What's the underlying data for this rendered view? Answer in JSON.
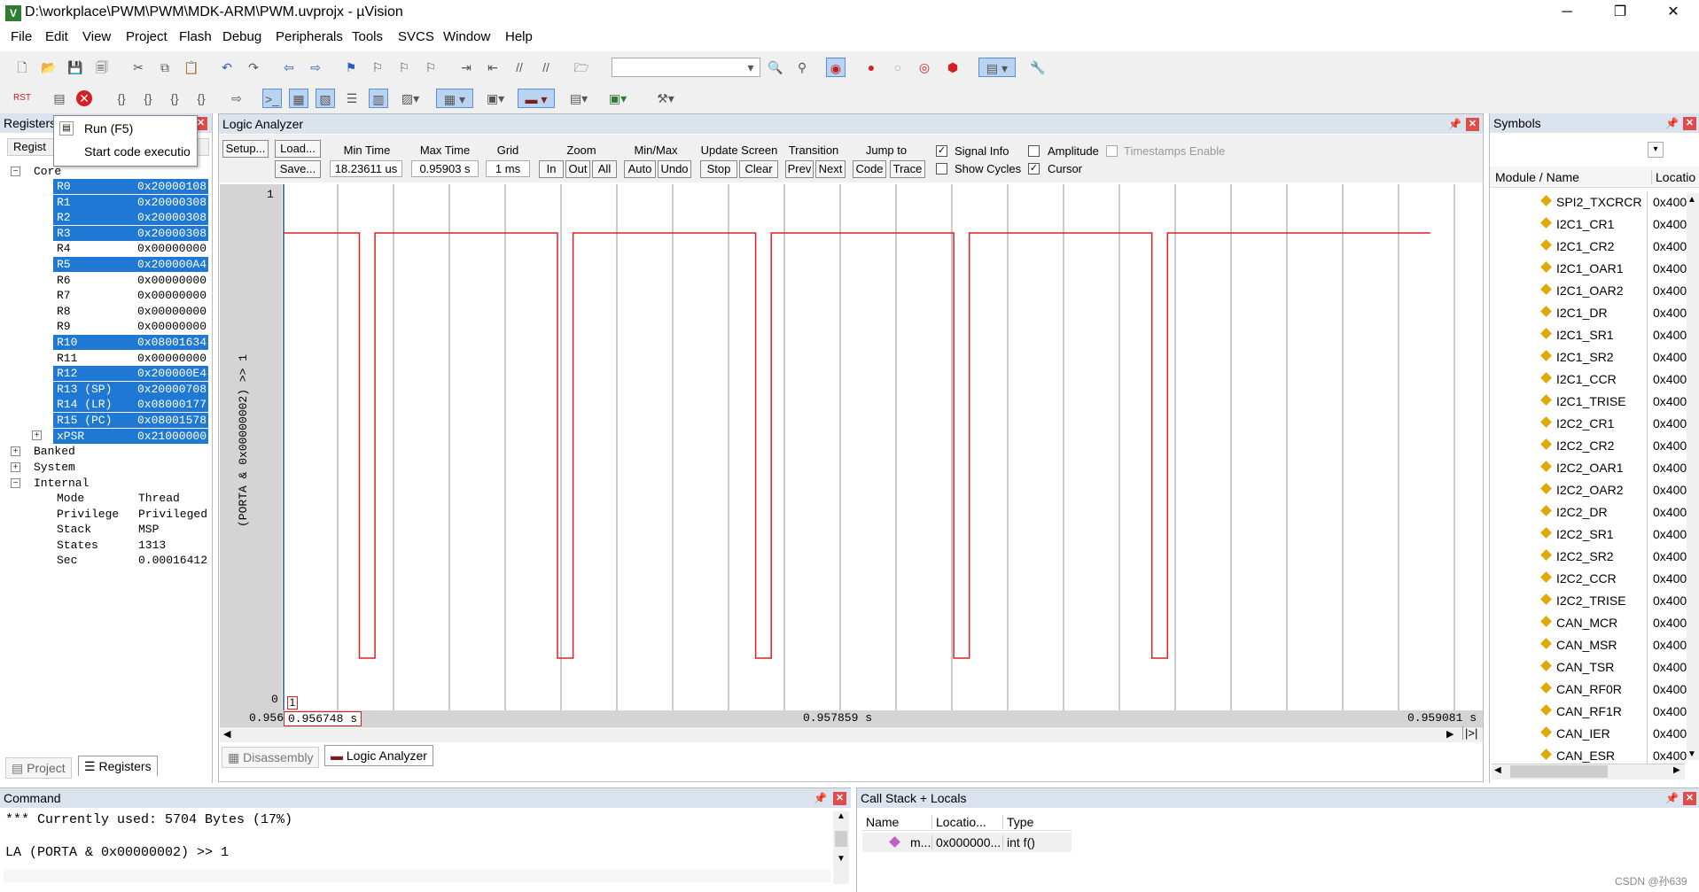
{
  "window": {
    "title": "D:\\workplace\\PWM\\PWM\\MDK-ARM\\PWM.uvprojx - µVision",
    "minimize": "─",
    "maximize": "❐",
    "close": "✕"
  },
  "menu": [
    "File",
    "Edit",
    "View",
    "Project",
    "Flash",
    "Debug",
    "Peripherals",
    "Tools",
    "SVCS",
    "Window",
    "Help"
  ],
  "tooltip": {
    "title": "Run (F5)",
    "desc": "Start code executio"
  },
  "registers": {
    "panel_title": "Registers",
    "col_header": "Regist",
    "core_label": "Core",
    "rows": [
      {
        "name": "R0",
        "value": "0x20000108",
        "sel": true
      },
      {
        "name": "R1",
        "value": "0x20000308",
        "sel": true
      },
      {
        "name": "R2",
        "value": "0x20000308",
        "sel": true
      },
      {
        "name": "R3",
        "value": "0x20000308",
        "sel": true
      },
      {
        "name": "R4",
        "value": "0x00000000",
        "sel": false
      },
      {
        "name": "R5",
        "value": "0x200000A4",
        "sel": true
      },
      {
        "name": "R6",
        "value": "0x00000000",
        "sel": false
      },
      {
        "name": "R7",
        "value": "0x00000000",
        "sel": false
      },
      {
        "name": "R8",
        "value": "0x00000000",
        "sel": false
      },
      {
        "name": "R9",
        "value": "0x00000000",
        "sel": false
      },
      {
        "name": "R10",
        "value": "0x08001634",
        "sel": true
      },
      {
        "name": "R11",
        "value": "0x00000000",
        "sel": false
      },
      {
        "name": "R12",
        "value": "0x200000E4",
        "sel": true
      },
      {
        "name": "R13 (SP)",
        "value": "0x20000708",
        "sel": true
      },
      {
        "name": "R14 (LR)",
        "value": "0x08000177",
        "sel": true
      },
      {
        "name": "R15 (PC)",
        "value": "0x08001578",
        "sel": true
      },
      {
        "name": "xPSR",
        "value": "0x21000000",
        "sel": true
      }
    ],
    "banked": "Banked",
    "system": "System",
    "internal": "Internal",
    "internal_rows": [
      {
        "name": "Mode",
        "value": "Thread"
      },
      {
        "name": "Privilege",
        "value": "Privileged"
      },
      {
        "name": "Stack",
        "value": "MSP"
      },
      {
        "name": "States",
        "value": "1313"
      },
      {
        "name": "Sec",
        "value": "0.00016412"
      }
    ],
    "tab_project": "Project",
    "tab_registers": "Registers"
  },
  "logic_analyzer": {
    "panel_title": "Logic Analyzer",
    "setup": "Setup...",
    "load": "Load...",
    "save": "Save...",
    "min_time_label": "Min Time",
    "min_time": "18.23611 us",
    "max_time_label": "Max Time",
    "max_time": "0.95903 s",
    "grid_label": "Grid",
    "grid": "1 ms",
    "zoom_label": "Zoom",
    "zoom_in": "In",
    "zoom_out": "Out",
    "zoom_all": "All",
    "minmax_label": "Min/Max",
    "auto": "Auto",
    "undo": "Undo",
    "update_label": "Update Screen",
    "stop": "Stop",
    "clear": "Clear",
    "transition_label": "Transition",
    "prev": "Prev",
    "next": "Next",
    "jump_label": "Jump to",
    "code": "Code",
    "trace": "Trace",
    "signal_info": "Signal Info",
    "show_cycles": "Show Cycles",
    "amplitude": "Amplitude",
    "cursor": "Cursor",
    "timestamps": "Timestamps Enable",
    "signal_name": "(PORTA & 0x00000002) >> 1",
    "y_high": "1",
    "y_low": "0",
    "cursor_marker": "1",
    "t_left": "0.956",
    "t_cursor": "0.956748 s",
    "t_mid": "0.957859 s",
    "t_right": "0.959081 s",
    "scroll_end": "|>|"
  },
  "signal": {
    "t_start": 0.95656,
    "t_end": 0.959081,
    "edges": [
      {
        "fall": 0.956724,
        "rise": 0.956757
      },
      {
        "fall": 0.957143,
        "rise": 0.957176
      },
      {
        "fall": 0.957562,
        "rise": 0.957595
      },
      {
        "fall": 0.957981,
        "rise": 0.958014
      },
      {
        "fall": 0.9584,
        "rise": 0.958433
      }
    ],
    "t_data_end": 0.958989
  },
  "tabs_bottom": {
    "disassembly": "Disassembly",
    "logic_analyzer": "Logic Analyzer"
  },
  "symbols": {
    "panel_title": "Symbols",
    "col_module": "Module / Name",
    "col_location": "Locatio",
    "rows": [
      {
        "name": "SPI2_TXCRCR",
        "loc": "0x400"
      },
      {
        "name": "I2C1_CR1",
        "loc": "0x400"
      },
      {
        "name": "I2C1_CR2",
        "loc": "0x400"
      },
      {
        "name": "I2C1_OAR1",
        "loc": "0x400"
      },
      {
        "name": "I2C1_OAR2",
        "loc": "0x400"
      },
      {
        "name": "I2C1_DR",
        "loc": "0x400"
      },
      {
        "name": "I2C1_SR1",
        "loc": "0x400"
      },
      {
        "name": "I2C1_SR2",
        "loc": "0x400"
      },
      {
        "name": "I2C1_CCR",
        "loc": "0x400"
      },
      {
        "name": "I2C1_TRISE",
        "loc": "0x400"
      },
      {
        "name": "I2C2_CR1",
        "loc": "0x400"
      },
      {
        "name": "I2C2_CR2",
        "loc": "0x400"
      },
      {
        "name": "I2C2_OAR1",
        "loc": "0x400"
      },
      {
        "name": "I2C2_OAR2",
        "loc": "0x400"
      },
      {
        "name": "I2C2_DR",
        "loc": "0x400"
      },
      {
        "name": "I2C2_SR1",
        "loc": "0x400"
      },
      {
        "name": "I2C2_SR2",
        "loc": "0x400"
      },
      {
        "name": "I2C2_CCR",
        "loc": "0x400"
      },
      {
        "name": "I2C2_TRISE",
        "loc": "0x400"
      },
      {
        "name": "CAN_MCR",
        "loc": "0x400"
      },
      {
        "name": "CAN_MSR",
        "loc": "0x400"
      },
      {
        "name": "CAN_TSR",
        "loc": "0x400"
      },
      {
        "name": "CAN_RF0R",
        "loc": "0x400"
      },
      {
        "name": "CAN_RF1R",
        "loc": "0x400"
      },
      {
        "name": "CAN_IER",
        "loc": "0x400"
      },
      {
        "name": "CAN_ESR",
        "loc": "0x400"
      }
    ]
  },
  "command": {
    "panel_title": "Command",
    "line1": "*** Currently used: 5704 Bytes (17%)",
    "line2": "LA (PORTA & 0x00000002) >> 1"
  },
  "callstack": {
    "panel_title": "Call Stack + Locals",
    "col_name": "Name",
    "col_location": "Locatio...",
    "col_type": "Type",
    "row_name": "m...",
    "row_location": "0x000000...",
    "row_type": "int f()"
  },
  "watermark": "CSDN @孙639"
}
